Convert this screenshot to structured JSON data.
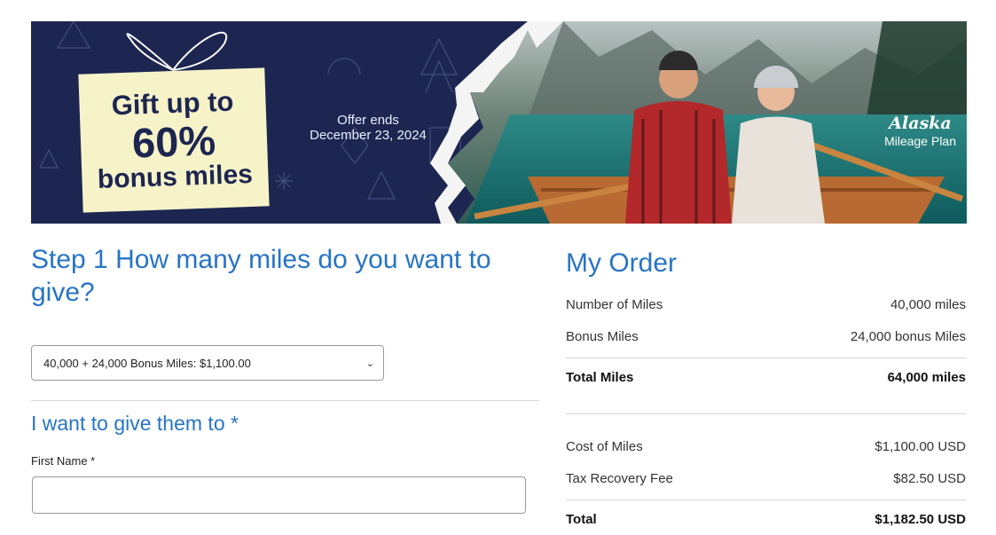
{
  "banner": {
    "gift_line1": "Gift up to",
    "gift_line2": "60%",
    "gift_line3": "bonus miles",
    "offer_line1": "Offer ends",
    "offer_line2": "December 23, 2024",
    "brand_line1": "Alaska",
    "brand_line2": "Mileage Plan"
  },
  "step1": {
    "title": "Step 1 How many miles do you want to give?",
    "select_value": "40,000 + 24,000 Bonus Miles: $1,100.00"
  },
  "recipient": {
    "title": "I want to give them to *",
    "first_name_label": "First Name *",
    "first_name_value": ""
  },
  "order": {
    "title": "My Order",
    "rows": [
      {
        "label": "Number of Miles",
        "value": "40,000 miles"
      },
      {
        "label": "Bonus Miles",
        "value": "24,000 bonus Miles"
      },
      {
        "label": "Total Miles",
        "value": "64,000 miles"
      },
      {
        "label": "Cost of Miles",
        "value": "$1,100.00 USD"
      },
      {
        "label": "Tax Recovery Fee",
        "value": "$82.50 USD"
      },
      {
        "label": "Total",
        "value": "$1,182.50 USD"
      }
    ]
  },
  "colors": {
    "accent": "#2774c5",
    "banner_navy": "#1d2650",
    "gift_card": "#f7f3c9"
  }
}
